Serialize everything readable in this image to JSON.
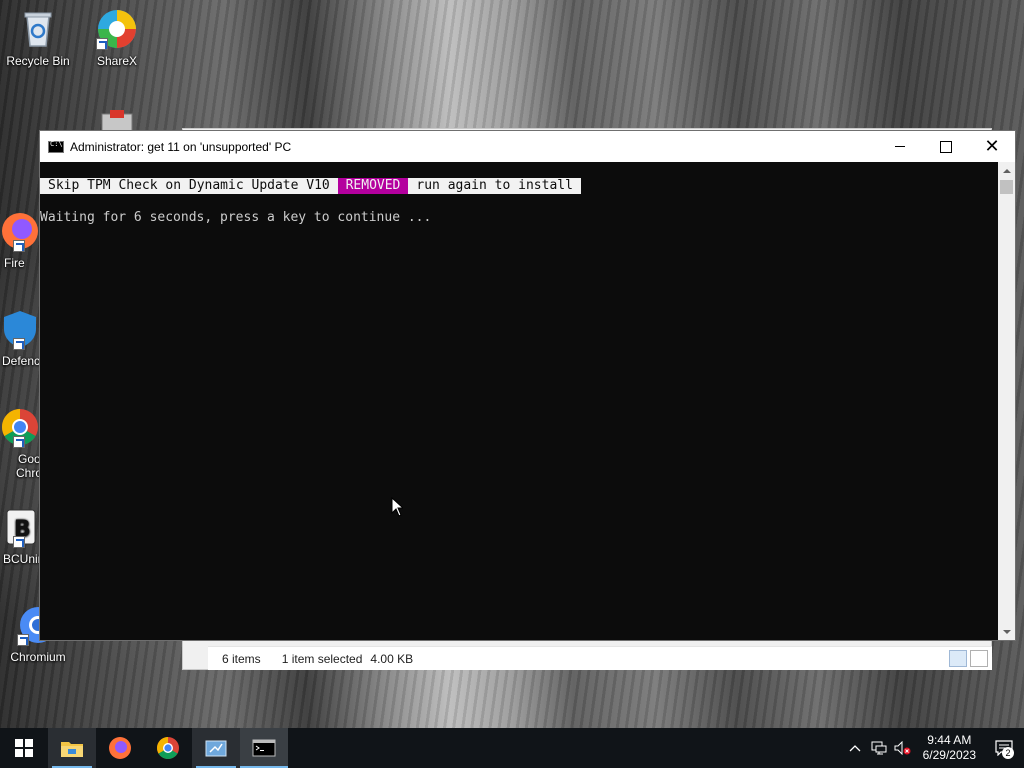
{
  "desktop": {
    "icons": [
      {
        "label": "Recycle Bin",
        "icon": "recycle-bin-icon"
      },
      {
        "label": "ShareX",
        "icon": "sharex-icon"
      },
      {
        "label": "Fire",
        "icon": "firefox-icon"
      },
      {
        "label": "Defenc",
        "icon": "defender-icon"
      },
      {
        "label": "Goo",
        "label2": "Chro",
        "icon": "chrome-icon"
      },
      {
        "label": "BCUnin",
        "icon": "bcuninstaller-icon"
      },
      {
        "label": "Chromium",
        "icon": "chromium-icon"
      }
    ]
  },
  "console": {
    "title": "Administrator:  get 11 on 'unsupported' PC",
    "banner": {
      "part1": "Skip TPM Check on Dynamic Update V10 ",
      "part2": "REMOVED",
      "part3": "run again to install"
    },
    "line": "Waiting for 6 seconds, press a key to continue ...",
    "colors": {
      "background": "#0c0c0c",
      "text": "#cccccc",
      "highlight": "#b4009e"
    }
  },
  "explorer": {
    "status": {
      "items": "6 items",
      "selected": "1 item selected",
      "size": "4.00 KB"
    }
  },
  "taskbar": {
    "apps": [
      {
        "name": "start",
        "icon": "windows-start-icon"
      },
      {
        "name": "file-explorer",
        "icon": "folder-icon"
      },
      {
        "name": "firefox",
        "icon": "firefox-icon"
      },
      {
        "name": "chrome",
        "icon": "chrome-icon"
      },
      {
        "name": "settings-app",
        "icon": "app-window-icon"
      },
      {
        "name": "cmd",
        "icon": "cmd-icon"
      }
    ],
    "clock": {
      "time": "9:44 AM",
      "date": "6/29/2023"
    },
    "notifications": "2"
  }
}
